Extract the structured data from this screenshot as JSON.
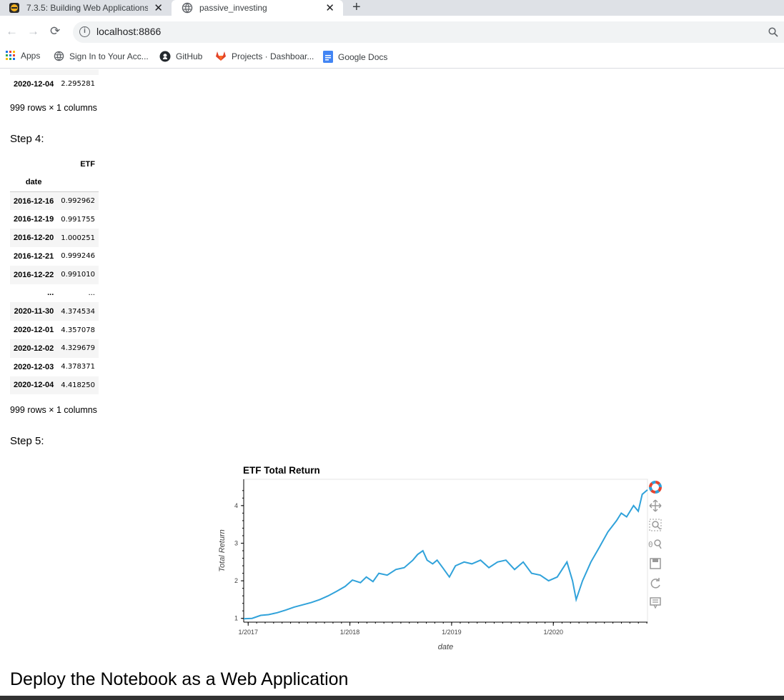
{
  "browser": {
    "tabs": [
      {
        "title": "7.3.5: Building Web Applications",
        "active": false
      },
      {
        "title": "passive_investing",
        "active": true
      }
    ],
    "url": "localhost:8866",
    "bookmarks": [
      "Apps",
      "Sign In to Your Acc...",
      "GitHub",
      "Projects · Dashboar...",
      "Google Docs"
    ]
  },
  "notebook": {
    "top_table": {
      "rows": [
        {
          "date": "2020-12-04",
          "value": "2.295281"
        }
      ],
      "shape": "999 rows × 1 columns"
    },
    "step4": {
      "heading": "Step 4:",
      "column": "ETF",
      "index_name": "date",
      "rows": [
        {
          "date": "2016-12-16",
          "value": "0.992962"
        },
        {
          "date": "2016-12-19",
          "value": "0.991755"
        },
        {
          "date": "2016-12-20",
          "value": "1.000251"
        },
        {
          "date": "2016-12-21",
          "value": "0.999246"
        },
        {
          "date": "2016-12-22",
          "value": "0.991010"
        },
        {
          "date": "...",
          "value": "..."
        },
        {
          "date": "2020-11-30",
          "value": "4.374534"
        },
        {
          "date": "2020-12-01",
          "value": "4.357078"
        },
        {
          "date": "2020-12-02",
          "value": "4.329679"
        },
        {
          "date": "2020-12-03",
          "value": "4.378371"
        },
        {
          "date": "2020-12-04",
          "value": "4.418250"
        }
      ],
      "shape": "999 rows × 1 columns"
    },
    "step5": {
      "heading": "Step 5:"
    },
    "deploy_heading": "Deploy the Notebook as a Web Application"
  },
  "chart_data": {
    "type": "line",
    "title": "ETF Total Return",
    "xlabel": "date",
    "ylabel": "Total Return",
    "xlim": [
      "2016-12-16",
      "2020-12-04"
    ],
    "ylim": [
      0.9,
      4.7
    ],
    "xticks": [
      "1/2017",
      "1/2018",
      "1/2019",
      "1/2020"
    ],
    "yticks": [
      1,
      2,
      3,
      4
    ],
    "color": "#30a2da",
    "grid": false,
    "series": [
      {
        "x": [
          "2016-12-16",
          "2017-01-15",
          "2017-02-15",
          "2017-03-15",
          "2017-04-15",
          "2017-05-15",
          "2017-06-15",
          "2017-07-15",
          "2017-08-15",
          "2017-09-15",
          "2017-10-15",
          "2017-11-15",
          "2017-12-15",
          "2018-01-10",
          "2018-02-08",
          "2018-03-01",
          "2018-03-25",
          "2018-04-15",
          "2018-05-15",
          "2018-06-15",
          "2018-07-15",
          "2018-08-15",
          "2018-09-01",
          "2018-09-20",
          "2018-10-05",
          "2018-10-25",
          "2018-11-10",
          "2018-11-30",
          "2018-12-24",
          "2019-01-15",
          "2019-02-15",
          "2019-03-15",
          "2019-04-15",
          "2019-05-15",
          "2019-06-15",
          "2019-07-15",
          "2019-08-15",
          "2019-09-15",
          "2019-10-15",
          "2019-11-15",
          "2019-12-15",
          "2020-01-15",
          "2020-02-19",
          "2020-03-10",
          "2020-03-23",
          "2020-04-15",
          "2020-05-15",
          "2020-06-15",
          "2020-07-15",
          "2020-08-15",
          "2020-09-01",
          "2020-09-20",
          "2020-10-15",
          "2020-11-01",
          "2020-11-15",
          "2020-12-04"
        ],
        "values": [
          0.99,
          1.0,
          1.08,
          1.1,
          1.15,
          1.22,
          1.3,
          1.36,
          1.42,
          1.5,
          1.6,
          1.72,
          1.85,
          2.02,
          1.95,
          2.1,
          1.98,
          2.2,
          2.15,
          2.3,
          2.35,
          2.55,
          2.7,
          2.8,
          2.55,
          2.45,
          2.55,
          2.35,
          2.1,
          2.4,
          2.5,
          2.45,
          2.55,
          2.35,
          2.5,
          2.55,
          2.3,
          2.5,
          2.2,
          2.15,
          2.0,
          2.1,
          2.5,
          2.0,
          1.5,
          2.0,
          2.5,
          2.9,
          3.3,
          3.6,
          3.8,
          3.7,
          4.0,
          3.85,
          4.3,
          4.42
        ]
      }
    ]
  }
}
